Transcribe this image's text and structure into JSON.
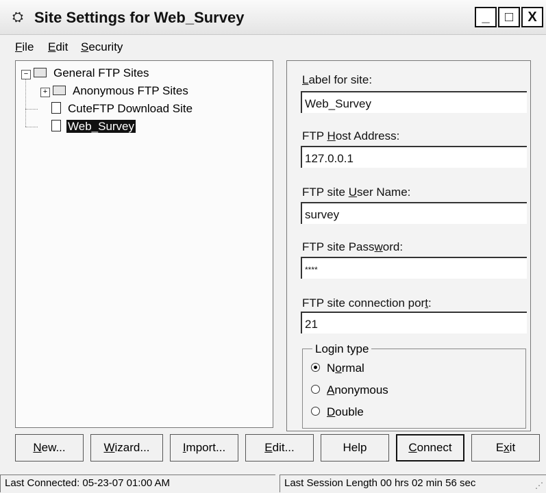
{
  "window": {
    "title": "Site Settings for Web_Survey",
    "icon": "site-settings-icon"
  },
  "title_controls": {
    "minimize": "_",
    "maximize": "□",
    "close": "X"
  },
  "menu": {
    "file": {
      "mn": "F",
      "rest": "ile"
    },
    "edit": {
      "mn": "E",
      "rest": "dit"
    },
    "security": {
      "mn": "S",
      "rest": "ecurity"
    }
  },
  "tree": {
    "root": {
      "label": "General FTP Sites",
      "expander": "−"
    },
    "anonymous": {
      "label": "Anonymous FTP Sites",
      "expander": "+"
    },
    "cuteftp": {
      "label": "CuteFTP Download Site"
    },
    "web_survey": {
      "label": "Web_Survey"
    }
  },
  "form": {
    "label_for_site": {
      "pre": "",
      "mn": "L",
      "post": "abel for site:",
      "value": "Web_Survey"
    },
    "host": {
      "pre": "FTP ",
      "mn": "H",
      "post": "ost Address:",
      "value": "127.0.0.1"
    },
    "user": {
      "pre": "FTP site ",
      "mn": "U",
      "post": "ser Name:",
      "value": "survey"
    },
    "password": {
      "pre": "FTP site Pass",
      "mn": "w",
      "post": "ord:",
      "value": "****"
    },
    "port": {
      "pre": "FTP site connection por",
      "mn": "t",
      "post": ":",
      "value": "21"
    }
  },
  "login_type": {
    "legend": "Login type",
    "selected": "Normal",
    "normal": {
      "pre": "N",
      "mn": "o",
      "post": "rmal"
    },
    "anonymous": {
      "pre": "",
      "mn": "A",
      "post": "nonymous"
    },
    "double": {
      "pre": "",
      "mn": "D",
      "post": "ouble"
    }
  },
  "buttons": {
    "new": {
      "mn": "N",
      "post": "ew..."
    },
    "wizard": {
      "mn": "W",
      "post": "izard..."
    },
    "import": {
      "mn": "I",
      "post": "mport..."
    },
    "edit": {
      "mn": "E",
      "post": "dit..."
    },
    "help": {
      "label": "Help"
    },
    "connect": {
      "mn": "C",
      "post": "onnect"
    },
    "exit": {
      "pre": "E",
      "mn": "x",
      "post": "it"
    }
  },
  "status": {
    "last_connected": "Last Connected: 05-23-07 01:00 AM",
    "session_length": "Last Session Length 00 hrs 02 min 56 sec"
  }
}
